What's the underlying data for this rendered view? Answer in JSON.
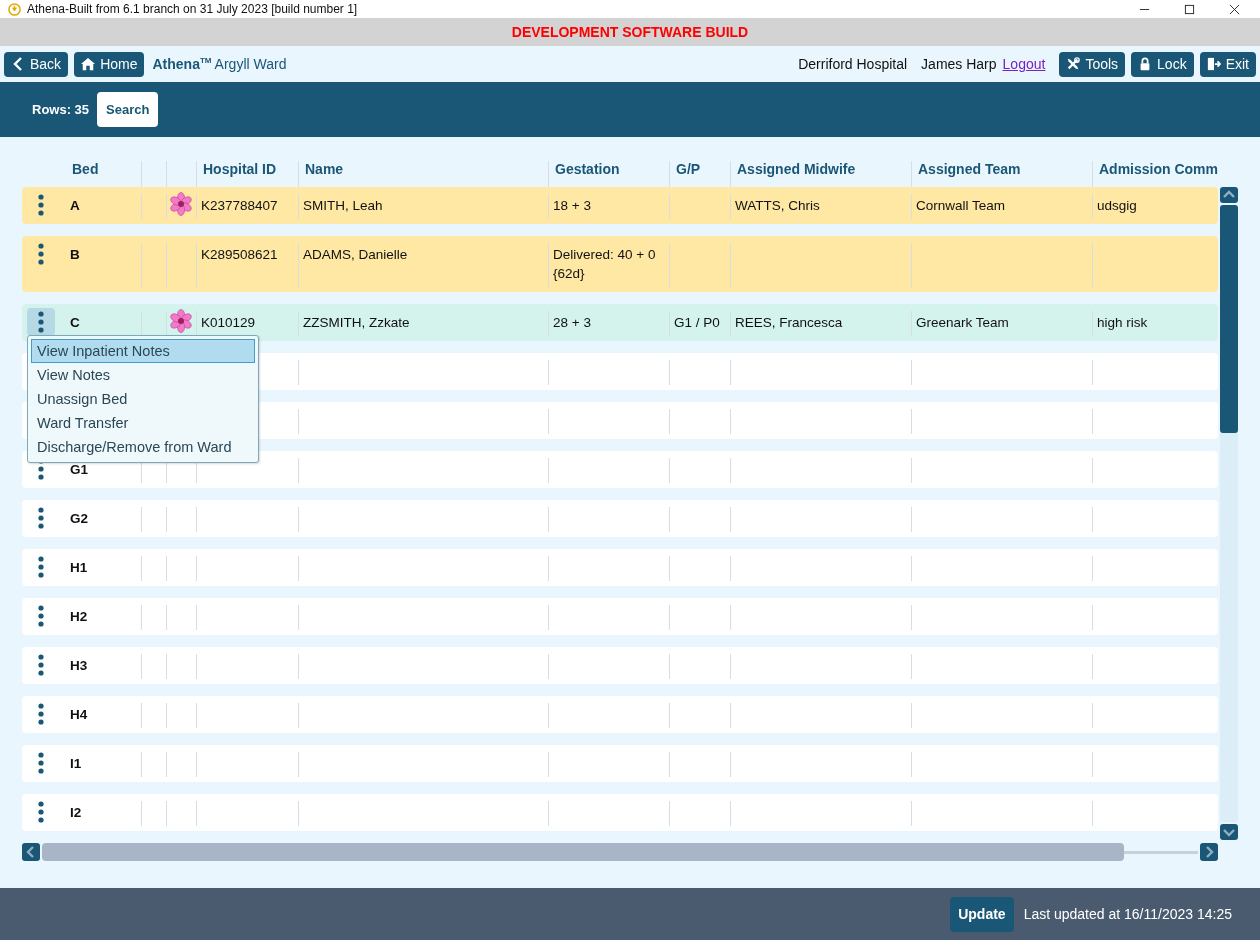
{
  "window": {
    "title": "Athena-Built from 6.1 branch on 31 July 2023 [build number 1]"
  },
  "banner": "DEVELOPMENT SOFTWARE BUILD",
  "nav": {
    "back": "Back",
    "home": "Home",
    "brand": "Athena",
    "brand_mark": "TM",
    "ward": "Argyll Ward",
    "hospital": "Derriford Hospital",
    "user": "James Harp",
    "logout": "Logout",
    "tools": "Tools",
    "lock": "Lock",
    "exit": "Exit"
  },
  "toolbar": {
    "rows": "Rows: 35",
    "search": "Search"
  },
  "table": {
    "columns": [
      "Bed",
      "",
      "",
      "Hospital ID",
      "Name",
      "Gestation",
      "G/P",
      "Assigned Midwife",
      "Assigned Team",
      "Admission Comm"
    ],
    "rows": [
      {
        "bed": "A",
        "flower": true,
        "hospital_id": "K237788407",
        "name": "SMITH, Leah",
        "gestation": "18 + 3",
        "gp": "",
        "midwife": "WATTS, Chris",
        "team": "Cornwall Team",
        "comments": "udsgig",
        "color": "#ffe8a3",
        "menu_open": false
      },
      {
        "bed": "B",
        "flower": false,
        "hospital_id": "K289508621",
        "name": "ADAMS, Danielle",
        "gestation": "Delivered: 40 + 0 {62d}",
        "gp": "",
        "midwife": "",
        "team": "",
        "comments": "",
        "color": "#ffe8a3",
        "menu_open": false
      },
      {
        "bed": "C",
        "flower": true,
        "hospital_id": "K010129",
        "name": "ZZSMITH, Zzkate",
        "gestation": "28 + 3",
        "gp": "G1 / P0",
        "midwife": "REES, Francesca",
        "team": "Greenark Team",
        "comments": "high risk",
        "color": "#d3f3ec",
        "menu_open": true
      },
      {
        "flower": false,
        "color": "#ffffff"
      },
      {
        "flower": false,
        "color": "#ffffff"
      },
      {
        "bed": "G1",
        "flower": false,
        "color": "#ffffff",
        "menu_open": false
      },
      {
        "bed": "G2",
        "flower": false,
        "color": "#ffffff",
        "menu_open": false
      },
      {
        "bed": "H1",
        "flower": false,
        "color": "#ffffff",
        "menu_open": false
      },
      {
        "bed": "H2",
        "flower": false,
        "color": "#ffffff",
        "menu_open": false
      },
      {
        "bed": "H3",
        "flower": false,
        "color": "#ffffff",
        "menu_open": false
      },
      {
        "bed": "H4",
        "flower": false,
        "color": "#ffffff",
        "menu_open": false
      },
      {
        "bed": "I1",
        "flower": false,
        "color": "#ffffff",
        "menu_open": false
      },
      {
        "bed": "I2",
        "flower": false,
        "color": "#ffffff",
        "menu_open": false
      }
    ]
  },
  "row_menu": [
    {
      "label": "View Inpatient Notes",
      "selected": true
    },
    {
      "label": "View Notes",
      "selected": false
    },
    {
      "label": "Unassign Bed",
      "selected": false
    },
    {
      "label": "Ward Transfer",
      "selected": false
    },
    {
      "label": "Discharge/Remove from Ward",
      "selected": false
    }
  ],
  "footer": {
    "update": "Update",
    "last_updated": "Last updated at 16/11/2023 14:25"
  }
}
